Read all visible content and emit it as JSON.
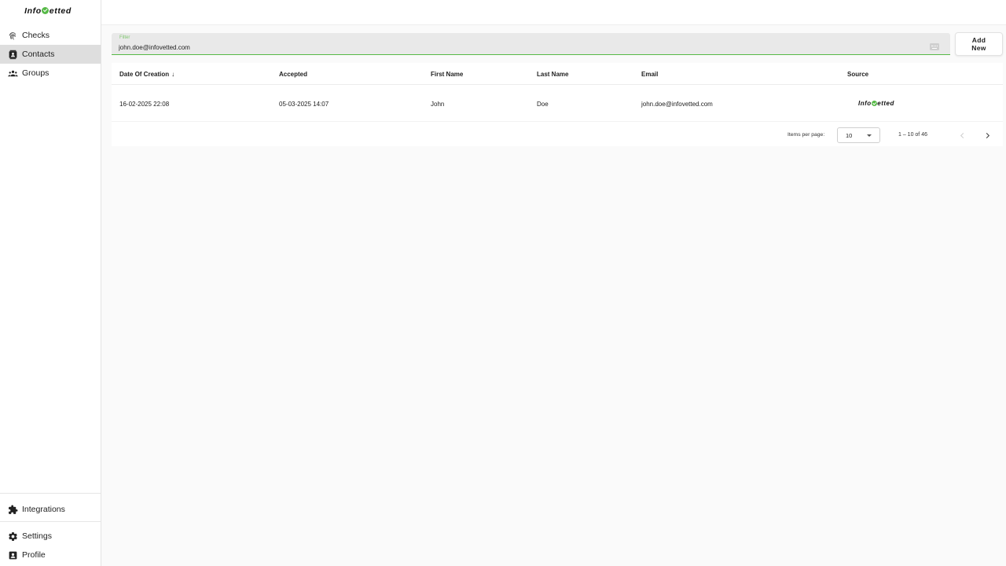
{
  "app": {
    "logo_prefix": "Info",
    "logo_suffix": "etted",
    "brand_color": "#56b947"
  },
  "sidebar": {
    "items": [
      {
        "label": "Checks",
        "icon": "fingerprint-icon"
      },
      {
        "label": "Contacts",
        "icon": "contacts-icon",
        "active": true
      },
      {
        "label": "Groups",
        "icon": "groups-icon"
      }
    ],
    "bottom_items": [
      {
        "label": "Integrations",
        "icon": "puzzle-icon"
      },
      {
        "label": "Settings",
        "icon": "gear-icon"
      },
      {
        "label": "Profile",
        "icon": "profile-icon"
      }
    ]
  },
  "filter": {
    "label": "Filter",
    "value": "john.doe@infovetted.com",
    "icon": "keyboard-icon"
  },
  "add_button": {
    "line1": "Add",
    "line2": "New"
  },
  "table": {
    "columns": [
      "Date Of Creation",
      "Accepted",
      "First Name",
      "Last Name",
      "Email",
      "Source"
    ],
    "sort_icon": "arrow-down-icon",
    "rows": [
      {
        "date_of_creation": "16-02-2025 22:08",
        "accepted": "05-03-2025 14:07",
        "first_name": "John",
        "last_name": "Doe",
        "email": "john.doe@infovetted.com",
        "source_prefix": "Info",
        "source_suffix": "etted"
      }
    ]
  },
  "paginator": {
    "items_per_page_label": "Items per page:",
    "items_per_page_value": "10",
    "range_label": "1 – 10 of 46"
  }
}
